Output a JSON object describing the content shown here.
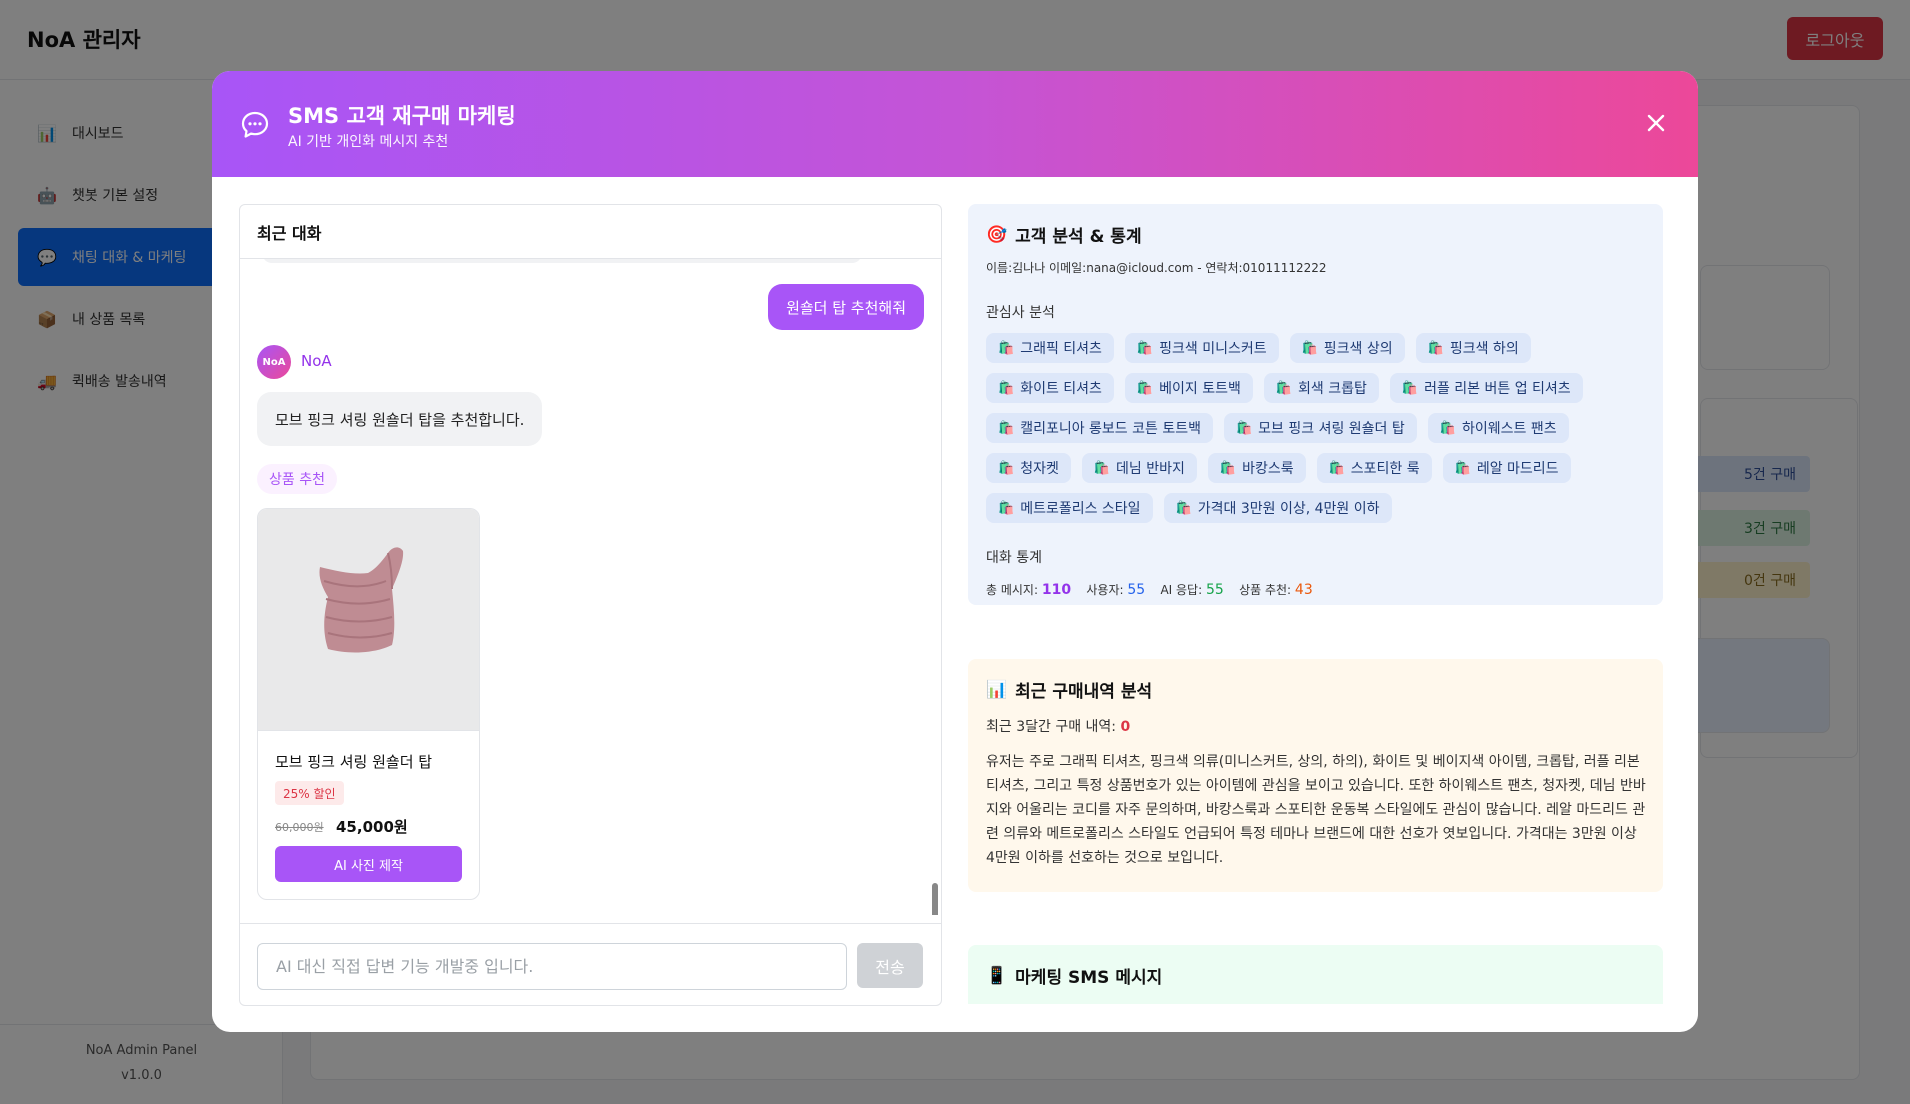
{
  "app": {
    "title": "NoA 관리자",
    "logout_label": "로그아웃",
    "sidebar": {
      "items": [
        {
          "label": "대시보드",
          "icon": "chart-icon",
          "glyph": "📊"
        },
        {
          "label": "챗봇 기본 설정",
          "icon": "robot-icon",
          "glyph": "🤖"
        },
        {
          "label": "채팅 대화 & 마케팅",
          "icon": "chat-icon",
          "glyph": "💬",
          "active": true
        },
        {
          "label": "내 상품 목록",
          "icon": "box-icon",
          "glyph": "📦"
        },
        {
          "label": "퀵배송 발송내역",
          "icon": "truck-icon",
          "glyph": "🚚"
        }
      ],
      "footer_name": "NoA Admin Panel",
      "footer_version": "v1.0.0"
    },
    "background_badges": [
      "5건 구매",
      "3건 구매",
      "0건 구매"
    ]
  },
  "modal": {
    "title": "SMS 고객 재구매 마케팅",
    "subtitle": "AI 기반 개인화 메시지 추천",
    "chat": {
      "header": "최근 대화",
      "user_message": "원숄더 탑 추천해줘",
      "bot_avatar_text": "NoA",
      "bot_name": "NoA",
      "bot_message": "모브 핑크 셔링 원숄더 탑을 추천합니다.",
      "recommend_tag": "상품 추천",
      "product": {
        "name": "모브 핑크 셔링 원숄더 탑",
        "discount": "25% 할인",
        "original_price": "60,000원",
        "sale_price": "45,000원",
        "ai_button": "AI 사진 제작"
      },
      "input_placeholder": "AI 대신 직접 답변 기능 개발중 입니다.",
      "send_label": "전송"
    },
    "analysis": {
      "title": "고객 분석 & 통계",
      "customer_info": "이름:김나나   이메일:nana@icloud.com -   연락처:01011112222",
      "interest_label": "관심사 분석",
      "interests": [
        "그래픽 티셔츠",
        "핑크색 미니스커트",
        "핑크색 상의",
        "핑크색 하의",
        "화이트 티셔츠",
        "베이지 토트백",
        "회색 크롭탑",
        "러플 리본 버튼 업 티셔츠",
        "캘리포니아 롱보드 코튼 토트백",
        "모브 핑크 셔링 원숄더 탑",
        "하이웨스트 팬츠",
        "청자켓",
        "데님 반바지",
        "바캉스룩",
        "스포티한 룩",
        "레알 마드리드",
        "메트로폴리스 스타일",
        "가격대 3만원 이상, 4만원 이하"
      ],
      "stats_label": "대화 통계",
      "stats": {
        "total_label": "총 메시지:",
        "total": "110",
        "user_label": "사용자:",
        "user": "55",
        "ai_label": "AI 응답:",
        "ai": "55",
        "rec_label": "상품 추천:",
        "rec": "43"
      }
    },
    "purchase": {
      "title": "최근 구매내역 분석",
      "count_label": "최근 3달간 구매 내역:",
      "count": "0",
      "text": "유저는 주로 그래픽 티셔츠, 핑크색 의류(미니스커트, 상의, 하의), 화이트 및 베이지색 아이템, 크롭탑, 러플 리본 티셔츠, 그리고 특정 상품번호가 있는 아이템에 관심을 보이고 있습니다. 또한 하이웨스트 팬츠, 청자켓, 데님 반바지와 어울리는 코디를 자주 문의하며, 바캉스룩과 스포티한 운동복 스타일에도 관심이 많습니다. 레알 마드리드 관련 의류와 메트로폴리스 스타일도 언급되어 특정 테마나 브랜드에 대한 선호가 엿보입니다. 가격대는 3만원 이상 4만원 이하를 선호하는 것으로 보입니다."
    },
    "sms": {
      "title": "마케팅 SMS 메시지"
    }
  }
}
